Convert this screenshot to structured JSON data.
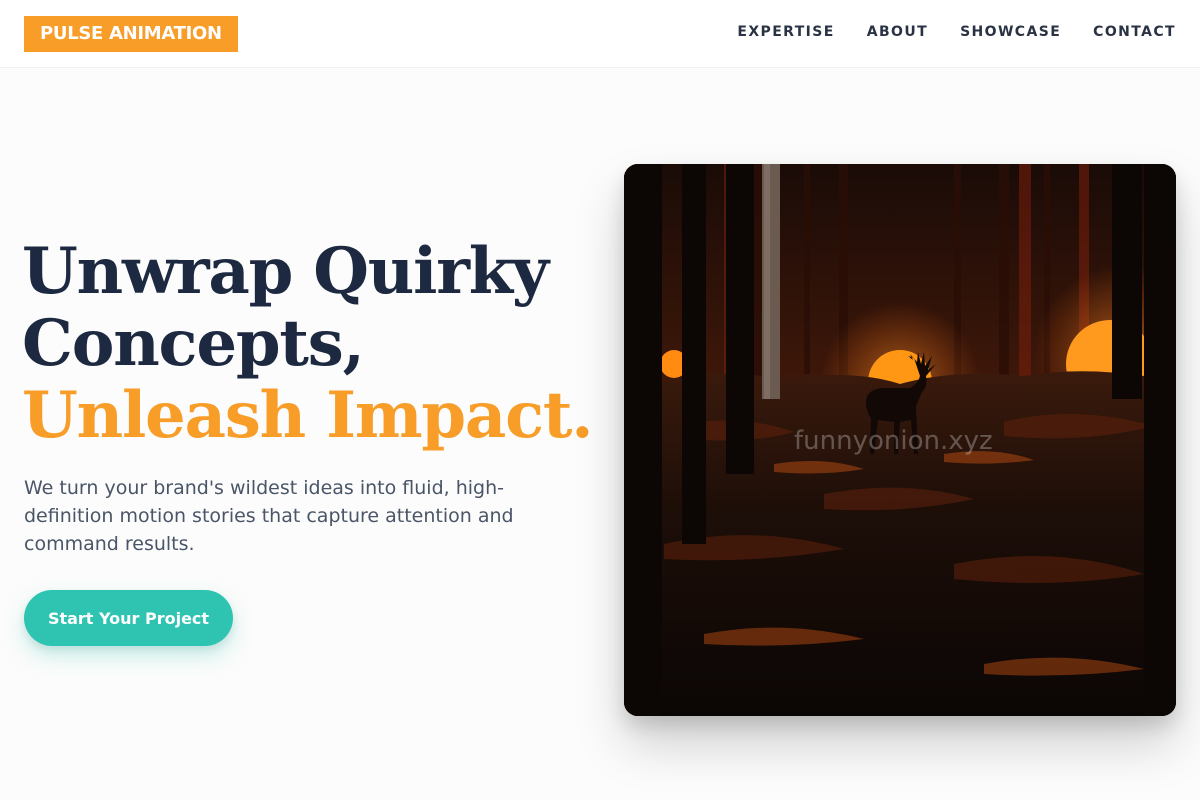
{
  "brand": {
    "logo_text": "PULSE ANIMATION",
    "accent": "#f79d28",
    "teal": "#2fc4b2",
    "navy": "#1d2940"
  },
  "nav": {
    "items": [
      "EXPERTISE",
      "ABOUT",
      "SHOWCASE",
      "CONTACT"
    ]
  },
  "hero": {
    "title_line1": "Unwrap Quirky",
    "title_line2": "Concepts,",
    "title_accent": "Unleash Impact.",
    "subtitle": "We turn your brand's wildest ideas into fluid, high-definition motion stories that capture attention and command results.",
    "cta_label": "Start Your Project",
    "image_alt": "Stag silhouette in a dark forest with glowing orange orbs",
    "watermark": "funnyonion.xyz"
  }
}
